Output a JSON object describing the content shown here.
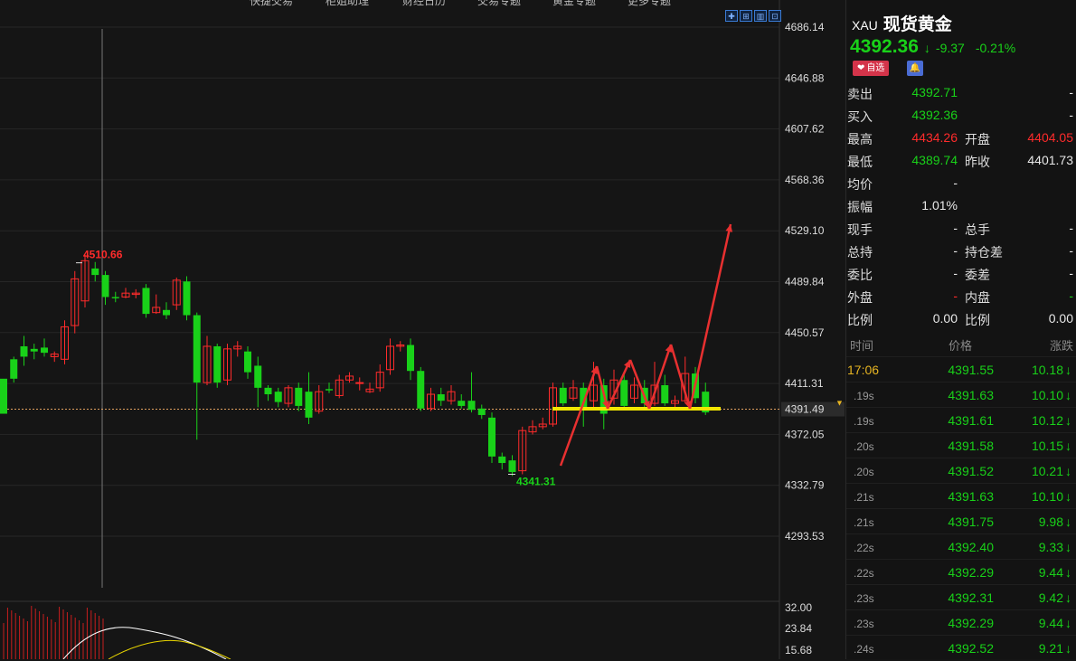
{
  "toolbar": {
    "items": [
      "",
      "",
      "",
      "",
      "快捷交易",
      "柜姐助理",
      "财经日历",
      "交易专题",
      "黄金专题",
      "更多专题"
    ],
    "icons": [
      "crosshair-icon",
      "draw-icon",
      "layout-icon",
      "zoom-icon"
    ]
  },
  "colors": {
    "up": "#ff2b2b",
    "down": "#19d119",
    "bg": "#151515",
    "annotation": "#e83030",
    "support": "#f2e600"
  },
  "chart": {
    "y_labels": [
      "4686.14",
      "4646.88",
      "4607.62",
      "4568.36",
      "4529.10",
      "4489.84",
      "4450.57",
      "4411.31",
      "4372.05",
      "4332.79",
      "4293.53"
    ],
    "current_price_label": "4391.49",
    "high_label": "4510.66",
    "low_label": "4341.31",
    "sub_labels": [
      "32.00",
      "23.84",
      "15.68"
    ]
  },
  "chart_data": {
    "type": "candlestick",
    "ylim": [
      4280,
      4700
    ],
    "y_ticks": [
      4686.14,
      4646.88,
      4607.62,
      4568.36,
      4529.1,
      4489.84,
      4450.57,
      4411.31,
      4372.05,
      4332.79,
      4293.53
    ],
    "current_price": 4391.49,
    "annotated_high": 4510.66,
    "annotated_low": 4341.31,
    "candles": [
      [
        4415,
        4388,
        4410,
        4388
      ],
      [
        4430,
        4415,
        4432,
        4412
      ],
      [
        4440,
        4432,
        4448,
        4425
      ],
      [
        4438,
        4436,
        4442,
        4430
      ],
      [
        4439,
        4435,
        4446,
        4432
      ],
      [
        4432,
        4434,
        4436,
        4428
      ],
      [
        4430,
        4455,
        4460,
        4426
      ],
      [
        4456,
        4492,
        4498,
        4450
      ],
      [
        4475,
        4506,
        4510.66,
        4470
      ],
      [
        4500,
        4495,
        4505,
        4490
      ],
      [
        4495,
        4478,
        4498,
        4472
      ],
      [
        4478,
        4477,
        4482,
        4474
      ],
      [
        4478,
        4481,
        4485,
        4477
      ],
      [
        4480,
        4481,
        4484,
        4477
      ],
      [
        4485,
        4465,
        4488,
        4462
      ],
      [
        4466,
        4470,
        4480,
        4465
      ],
      [
        4468,
        4464,
        4474,
        4461
      ],
      [
        4472,
        4491,
        4493,
        4468
      ],
      [
        4490,
        4464,
        4494,
        4460
      ],
      [
        4464,
        4412,
        4466,
        4368
      ],
      [
        4412,
        4440,
        4448,
        4410
      ],
      [
        4440,
        4412,
        4442,
        4408
      ],
      [
        4414,
        4438,
        4442,
        4410
      ],
      [
        4438,
        4440,
        4444,
        4432
      ],
      [
        4436,
        4420,
        4440,
        4415
      ],
      [
        4425,
        4408,
        4432,
        4393
      ],
      [
        4408,
        4403,
        4410,
        4398
      ],
      [
        4405,
        4397,
        4408,
        4393
      ],
      [
        4396,
        4408,
        4410,
        4393
      ],
      [
        4408,
        4394,
        4412,
        4390
      ],
      [
        4405,
        4385,
        4420,
        4380
      ],
      [
        4390,
        4405,
        4410,
        4388
      ],
      [
        4407,
        4406,
        4412,
        4404
      ],
      [
        4402,
        4414,
        4418,
        4400
      ],
      [
        4414,
        4417,
        4420,
        4412
      ],
      [
        4412,
        4412,
        4416,
        4406
      ],
      [
        4405,
        4407,
        4412,
        4404
      ],
      [
        4408,
        4420,
        4426,
        4405
      ],
      [
        4422,
        4440,
        4446,
        4418
      ],
      [
        4440,
        4441,
        4444,
        4436
      ],
      [
        4441,
        4421,
        4446,
        4414
      ],
      [
        4421,
        4392,
        4424,
        4390
      ],
      [
        4392,
        4403,
        4408,
        4390
      ],
      [
        4403,
        4398,
        4408,
        4394
      ],
      [
        4398,
        4405,
        4410,
        4395
      ],
      [
        4398,
        4394,
        4403,
        4392
      ],
      [
        4398,
        4391,
        4420,
        4389
      ],
      [
        4392,
        4387,
        4395,
        4384
      ],
      [
        4385,
        4355,
        4389,
        4350
      ],
      [
        4355,
        4350,
        4358,
        4345
      ],
      [
        4352,
        4343,
        4356,
        4340
      ],
      [
        4344,
        4375,
        4378,
        4341.31
      ],
      [
        4374,
        4378,
        4383,
        4372
      ],
      [
        4378,
        4380,
        4385,
        4376
      ],
      [
        4380,
        4408,
        4412,
        4378
      ],
      [
        4408,
        4396,
        4412,
        4394
      ],
      [
        4400,
        4408,
        4414,
        4398
      ],
      [
        4408,
        4392,
        4412,
        4378
      ],
      [
        4398,
        4410,
        4428,
        4393
      ],
      [
        4410,
        4388,
        4415,
        4376
      ],
      [
        4400,
        4414,
        4422,
        4395
      ],
      [
        4414,
        4394,
        4418,
        4392
      ],
      [
        4400,
        4410,
        4416,
        4396
      ],
      [
        4408,
        4396,
        4414,
        4392
      ],
      [
        4396,
        4410,
        4428,
        4394
      ],
      [
        4410,
        4396,
        4418,
        4394
      ],
      [
        4396,
        4398,
        4402,
        4392
      ],
      [
        4398,
        4419,
        4432,
        4396
      ],
      [
        4419,
        4400,
        4424,
        4396
      ],
      [
        4405,
        4389,
        4412,
        4387
      ]
    ],
    "annotation_arrows": [
      [
        [
          620,
          515
        ],
        [
          660,
          405
        ]
      ],
      [
        [
          660,
          405
        ],
        [
          672,
          452
        ]
      ],
      [
        [
          672,
          452
        ],
        [
          697,
          398
        ]
      ],
      [
        [
          697,
          398
        ],
        [
          718,
          452
        ]
      ],
      [
        [
          718,
          452
        ],
        [
          742,
          381
        ]
      ],
      [
        [
          742,
          381
        ],
        [
          763,
          452
        ]
      ],
      [
        [
          763,
          452
        ],
        [
          808,
          248
        ]
      ]
    ],
    "support_line": [
      4390.5,
      611,
      797
    ]
  },
  "panel": {
    "code": "XAU",
    "name": "现货黄金",
    "price": "4392.36",
    "change": "-9.37",
    "change_pct": "-0.21%",
    "fav_label": "自选",
    "quotes": [
      {
        "l": "卖出",
        "v": "4392.71",
        "vc": "g",
        "l2": "",
        "v2": "-",
        "v2c": "w"
      },
      {
        "l": "买入",
        "v": "4392.36",
        "vc": "g",
        "l2": "",
        "v2": "-",
        "v2c": "w"
      },
      {
        "l": "最高",
        "v": "4434.26",
        "vc": "r",
        "l2": "开盘",
        "v2": "4404.05",
        "v2c": "r"
      },
      {
        "l": "最低",
        "v": "4389.74",
        "vc": "g",
        "l2": "昨收",
        "v2": "4401.73",
        "v2c": "w"
      },
      {
        "l": "均价",
        "v": "-",
        "vc": "w",
        "l2": "",
        "v2": "",
        "v2c": "w"
      },
      {
        "l": "振幅",
        "v": "1.01%",
        "vc": "w",
        "l2": "",
        "v2": "",
        "v2c": "w"
      },
      {
        "l": "现手",
        "v": "-",
        "vc": "w",
        "l2": "总手",
        "v2": "-",
        "v2c": "w"
      },
      {
        "l": "总持",
        "v": "-",
        "vc": "w",
        "l2": "持仓差",
        "v2": "-",
        "v2c": "w"
      },
      {
        "l": "委比",
        "v": "-",
        "vc": "w",
        "l2": "委差",
        "v2": "-",
        "v2c": "w"
      },
      {
        "l": "外盘",
        "v": "-",
        "vc": "r",
        "l2": "内盘",
        "v2": "-",
        "v2c": "g"
      },
      {
        "l": "比例",
        "v": "0.00",
        "vc": "w",
        "l2": "比例",
        "v2": "0.00",
        "v2c": "w"
      }
    ],
    "tick_headers": {
      "time": "时间",
      "price": "价格",
      "change": "涨跌"
    },
    "ticks": [
      {
        "t": "17:06",
        "p": "4391.55",
        "c": "10.18"
      },
      {
        "t": ".19s",
        "p": "4391.63",
        "c": "10.10"
      },
      {
        "t": ".19s",
        "p": "4391.61",
        "c": "10.12"
      },
      {
        "t": ".20s",
        "p": "4391.58",
        "c": "10.15"
      },
      {
        "t": ".20s",
        "p": "4391.52",
        "c": "10.21"
      },
      {
        "t": ".21s",
        "p": "4391.63",
        "c": "10.10"
      },
      {
        "t": ".21s",
        "p": "4391.75",
        "c": "9.98"
      },
      {
        "t": ".22s",
        "p": "4392.40",
        "c": "9.33"
      },
      {
        "t": ".22s",
        "p": "4392.29",
        "c": "9.44"
      },
      {
        "t": ".23s",
        "p": "4392.31",
        "c": "9.42"
      },
      {
        "t": ".23s",
        "p": "4392.29",
        "c": "9.44"
      },
      {
        "t": ".24s",
        "p": "4392.52",
        "c": "9.21"
      }
    ]
  }
}
